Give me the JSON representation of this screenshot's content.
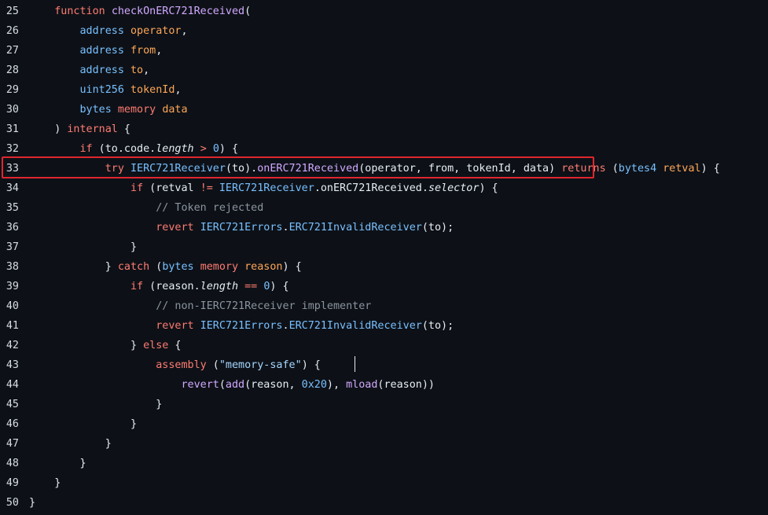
{
  "editor": {
    "highlighted_line": 33,
    "lines": [
      {
        "num": "25",
        "tokens": [
          {
            "t": "    ",
            "c": "d"
          },
          {
            "t": "function",
            "c": "k"
          },
          {
            "t": " ",
            "c": "d"
          },
          {
            "t": "checkOnERC721Received",
            "c": "f"
          },
          {
            "t": "(",
            "c": "d"
          }
        ]
      },
      {
        "num": "26",
        "tokens": [
          {
            "t": "        ",
            "c": "d"
          },
          {
            "t": "address",
            "c": "t"
          },
          {
            "t": " ",
            "c": "d"
          },
          {
            "t": "operator",
            "c": "p"
          },
          {
            "t": ",",
            "c": "d"
          }
        ]
      },
      {
        "num": "27",
        "tokens": [
          {
            "t": "        ",
            "c": "d"
          },
          {
            "t": "address",
            "c": "t"
          },
          {
            "t": " ",
            "c": "d"
          },
          {
            "t": "from",
            "c": "p"
          },
          {
            "t": ",",
            "c": "d"
          }
        ]
      },
      {
        "num": "28",
        "tokens": [
          {
            "t": "        ",
            "c": "d"
          },
          {
            "t": "address",
            "c": "t"
          },
          {
            "t": " ",
            "c": "d"
          },
          {
            "t": "to",
            "c": "p"
          },
          {
            "t": ",",
            "c": "d"
          }
        ]
      },
      {
        "num": "29",
        "tokens": [
          {
            "t": "        ",
            "c": "d"
          },
          {
            "t": "uint256",
            "c": "t"
          },
          {
            "t": " ",
            "c": "d"
          },
          {
            "t": "tokenId",
            "c": "p"
          },
          {
            "t": ",",
            "c": "d"
          }
        ]
      },
      {
        "num": "30",
        "tokens": [
          {
            "t": "        ",
            "c": "d"
          },
          {
            "t": "bytes",
            "c": "t"
          },
          {
            "t": " ",
            "c": "d"
          },
          {
            "t": "memory",
            "c": "k"
          },
          {
            "t": " ",
            "c": "d"
          },
          {
            "t": "data",
            "c": "p"
          }
        ]
      },
      {
        "num": "31",
        "tokens": [
          {
            "t": "    ) ",
            "c": "d"
          },
          {
            "t": "internal",
            "c": "k"
          },
          {
            "t": " {",
            "c": "d"
          }
        ]
      },
      {
        "num": "32",
        "tokens": [
          {
            "t": "        ",
            "c": "d"
          },
          {
            "t": "if",
            "c": "k"
          },
          {
            "t": " (to.code.",
            "c": "d"
          },
          {
            "t": "length",
            "c": "it"
          },
          {
            "t": " ",
            "c": "d"
          },
          {
            "t": ">",
            "c": "k"
          },
          {
            "t": " ",
            "c": "d"
          },
          {
            "t": "0",
            "c": "n"
          },
          {
            "t": ") {",
            "c": "d"
          }
        ]
      },
      {
        "num": "33",
        "tokens": [
          {
            "t": "            ",
            "c": "d"
          },
          {
            "t": "try",
            "c": "k"
          },
          {
            "t": " ",
            "c": "d"
          },
          {
            "t": "IERC721Receiver",
            "c": "t"
          },
          {
            "t": "(to).",
            "c": "d"
          },
          {
            "t": "onERC721Received",
            "c": "f"
          },
          {
            "t": "(operator, from, tokenId, data) ",
            "c": "d"
          },
          {
            "t": "returns",
            "c": "k"
          },
          {
            "t": " (",
            "c": "d"
          },
          {
            "t": "bytes4",
            "c": "t"
          },
          {
            "t": " ",
            "c": "d"
          },
          {
            "t": "retval",
            "c": "p"
          },
          {
            "t": ") {",
            "c": "d"
          }
        ]
      },
      {
        "num": "34",
        "tokens": [
          {
            "t": "                ",
            "c": "d"
          },
          {
            "t": "if",
            "c": "k"
          },
          {
            "t": " (retval ",
            "c": "d"
          },
          {
            "t": "!=",
            "c": "k"
          },
          {
            "t": " ",
            "c": "d"
          },
          {
            "t": "IERC721Receiver",
            "c": "t"
          },
          {
            "t": ".onERC721Received.",
            "c": "d"
          },
          {
            "t": "selector",
            "c": "it"
          },
          {
            "t": ") {",
            "c": "d"
          }
        ]
      },
      {
        "num": "35",
        "tokens": [
          {
            "t": "                    ",
            "c": "d"
          },
          {
            "t": "// Token rejected",
            "c": "c"
          }
        ]
      },
      {
        "num": "36",
        "tokens": [
          {
            "t": "                    ",
            "c": "d"
          },
          {
            "t": "revert",
            "c": "k"
          },
          {
            "t": " ",
            "c": "d"
          },
          {
            "t": "IERC721Errors",
            "c": "t"
          },
          {
            "t": ".",
            "c": "d"
          },
          {
            "t": "ERC721InvalidReceiver",
            "c": "t"
          },
          {
            "t": "(to);",
            "c": "d"
          }
        ]
      },
      {
        "num": "37",
        "tokens": [
          {
            "t": "                }",
            "c": "d"
          }
        ]
      },
      {
        "num": "38",
        "tokens": [
          {
            "t": "            } ",
            "c": "d"
          },
          {
            "t": "catch",
            "c": "k"
          },
          {
            "t": " (",
            "c": "d"
          },
          {
            "t": "bytes",
            "c": "t"
          },
          {
            "t": " ",
            "c": "d"
          },
          {
            "t": "memory",
            "c": "k"
          },
          {
            "t": " ",
            "c": "d"
          },
          {
            "t": "reason",
            "c": "p"
          },
          {
            "t": ") {",
            "c": "d"
          }
        ]
      },
      {
        "num": "39",
        "tokens": [
          {
            "t": "                ",
            "c": "d"
          },
          {
            "t": "if",
            "c": "k"
          },
          {
            "t": " (reason.",
            "c": "d"
          },
          {
            "t": "length",
            "c": "it"
          },
          {
            "t": " ",
            "c": "d"
          },
          {
            "t": "==",
            "c": "k"
          },
          {
            "t": " ",
            "c": "d"
          },
          {
            "t": "0",
            "c": "n"
          },
          {
            "t": ") {",
            "c": "d"
          }
        ]
      },
      {
        "num": "40",
        "tokens": [
          {
            "t": "                    ",
            "c": "d"
          },
          {
            "t": "// non-IERC721Receiver implementer",
            "c": "c"
          }
        ]
      },
      {
        "num": "41",
        "tokens": [
          {
            "t": "                    ",
            "c": "d"
          },
          {
            "t": "revert",
            "c": "k"
          },
          {
            "t": " ",
            "c": "d"
          },
          {
            "t": "IERC721Errors",
            "c": "t"
          },
          {
            "t": ".",
            "c": "d"
          },
          {
            "t": "ERC721InvalidReceiver",
            "c": "t"
          },
          {
            "t": "(to);",
            "c": "d"
          }
        ]
      },
      {
        "num": "42",
        "tokens": [
          {
            "t": "                } ",
            "c": "d"
          },
          {
            "t": "else",
            "c": "k"
          },
          {
            "t": " {",
            "c": "d"
          }
        ]
      },
      {
        "num": "43",
        "tokens": [
          {
            "t": "                    ",
            "c": "d"
          },
          {
            "t": "assembly",
            "c": "k"
          },
          {
            "t": " (",
            "c": "d"
          },
          {
            "t": "\"memory-safe\"",
            "c": "s"
          },
          {
            "t": ") {",
            "c": "d"
          }
        ]
      },
      {
        "num": "44",
        "tokens": [
          {
            "t": "                        ",
            "c": "d"
          },
          {
            "t": "revert",
            "c": "f"
          },
          {
            "t": "(",
            "c": "d"
          },
          {
            "t": "add",
            "c": "f"
          },
          {
            "t": "(reason, ",
            "c": "d"
          },
          {
            "t": "0x20",
            "c": "n"
          },
          {
            "t": "), ",
            "c": "d"
          },
          {
            "t": "mload",
            "c": "f"
          },
          {
            "t": "(reason))",
            "c": "d"
          }
        ]
      },
      {
        "num": "45",
        "tokens": [
          {
            "t": "                    }",
            "c": "d"
          }
        ]
      },
      {
        "num": "46",
        "tokens": [
          {
            "t": "                }",
            "c": "d"
          }
        ]
      },
      {
        "num": "47",
        "tokens": [
          {
            "t": "            }",
            "c": "d"
          }
        ]
      },
      {
        "num": "48",
        "tokens": [
          {
            "t": "        }",
            "c": "d"
          }
        ]
      },
      {
        "num": "49",
        "tokens": [
          {
            "t": "    }",
            "c": "d"
          }
        ]
      },
      {
        "num": "50",
        "tokens": [
          {
            "t": "}",
            "c": "d"
          }
        ]
      }
    ]
  }
}
